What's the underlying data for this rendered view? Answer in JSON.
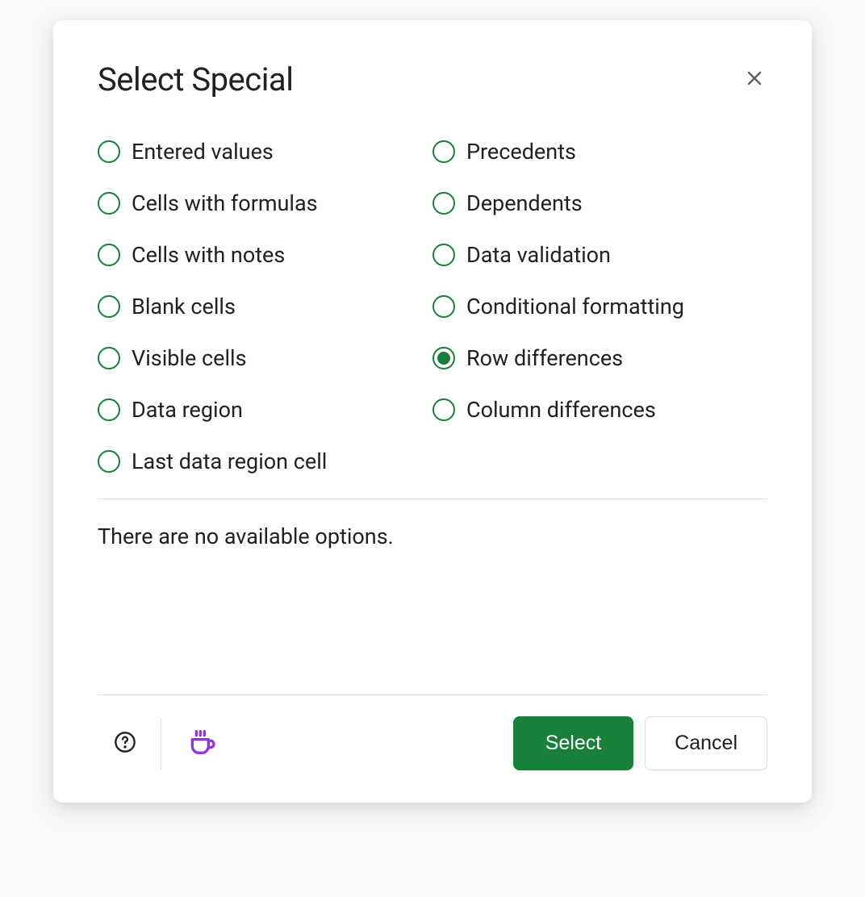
{
  "dialog": {
    "title": "Select Special",
    "options": {
      "entered_values": "Entered values",
      "cells_with_formulas": "Cells with formulas",
      "cells_with_notes": "Cells with notes",
      "blank_cells": "Blank cells",
      "visible_cells": "Visible cells",
      "data_region": "Data region",
      "last_data_region_cell": "Last data region cell",
      "precedents": "Precedents",
      "dependents": "Dependents",
      "data_validation": "Data validation",
      "conditional_formatting": "Conditional formatting",
      "row_differences": "Row differences",
      "column_differences": "Column differences"
    },
    "selected_option": "row_differences",
    "status_text": "There are no available options.",
    "buttons": {
      "select": "Select",
      "cancel": "Cancel"
    },
    "colors": {
      "accent_green": "#188038",
      "coffee_purple": "#9334e6"
    }
  }
}
